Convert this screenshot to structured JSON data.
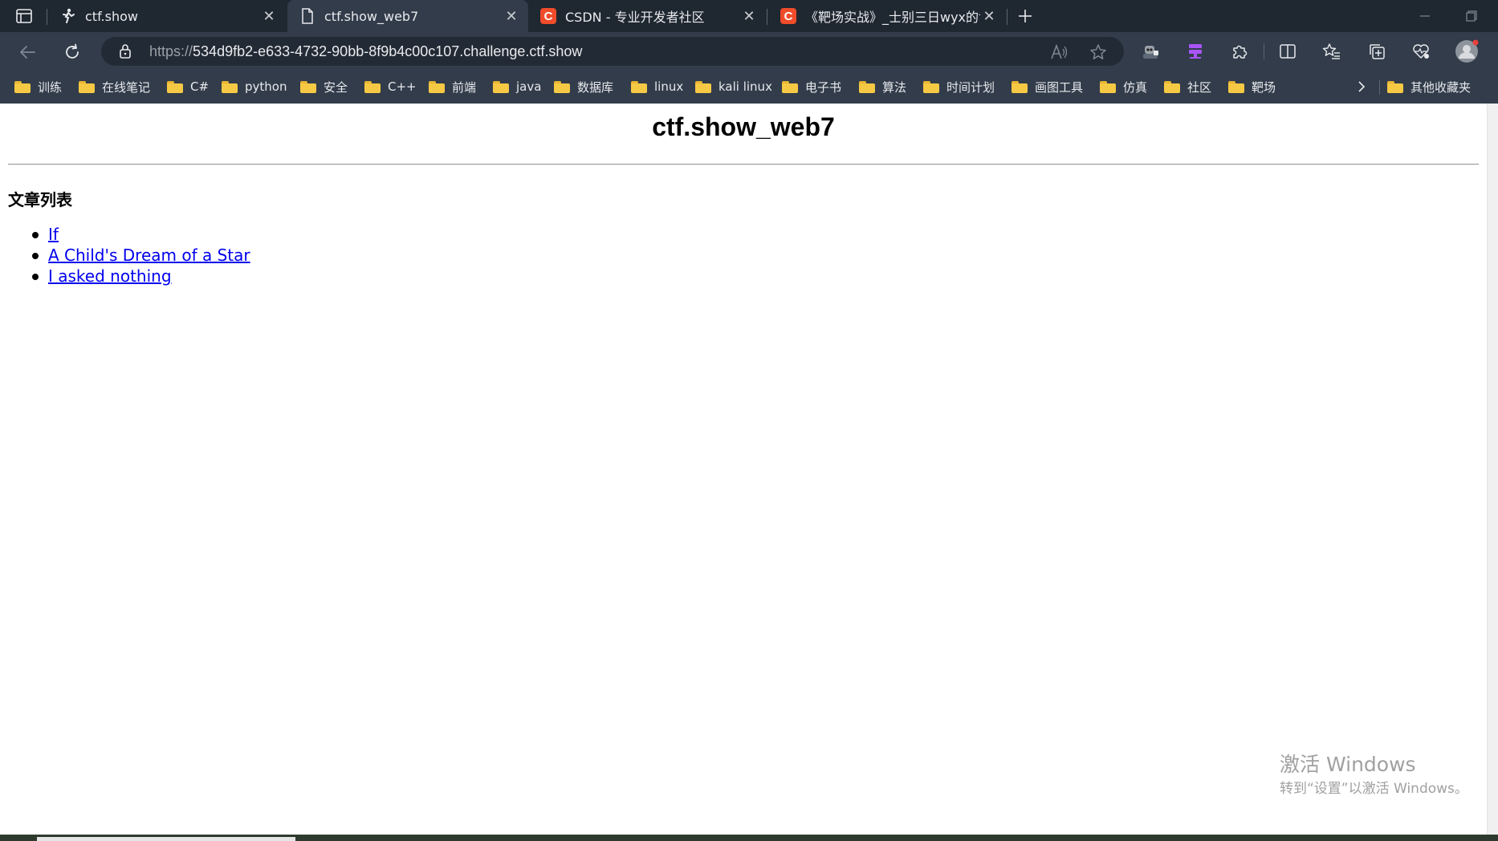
{
  "tabs": [
    {
      "title": "ctf.show",
      "icon": "ctfshow-figure-icon",
      "active": false
    },
    {
      "title": "ctf.show_web7",
      "icon": "page-icon",
      "active": true
    },
    {
      "title": "CSDN - 专业开发者社区",
      "icon": "csdn-logo-icon",
      "active": false
    },
    {
      "title": "《靶场实战》_士别三日wyx的博",
      "icon": "csdn-logo-icon",
      "active": false
    }
  ],
  "csdn_logo_letter": "C",
  "address_bar": {
    "scheme": "https://",
    "host": "534d9fb2-e633-4732-90bb-8f9b4c00c107.challenge.ctf.show"
  },
  "bookmarks": [
    {
      "label": "训练"
    },
    {
      "label": "在线笔记"
    },
    {
      "label": "C#"
    },
    {
      "label": "python"
    },
    {
      "label": "安全"
    },
    {
      "label": "C++"
    },
    {
      "label": "前端"
    },
    {
      "label": "java"
    },
    {
      "label": "数据库"
    },
    {
      "label": "linux"
    },
    {
      "label": "kali linux"
    },
    {
      "label": "电子书"
    },
    {
      "label": "算法"
    },
    {
      "label": "时间计划"
    },
    {
      "label": "画图工具"
    },
    {
      "label": "仿真"
    },
    {
      "label": "社区"
    },
    {
      "label": "靶场"
    }
  ],
  "other_bookmarks": "其他收藏夹",
  "page": {
    "title": "ctf.show_web7",
    "section_heading": "文章列表",
    "articles": [
      {
        "title": "If"
      },
      {
        "title": "A Child's Dream of a Star"
      },
      {
        "title": "I asked nothing"
      }
    ]
  },
  "watermark": {
    "title": "激活 Windows",
    "subtitle": "转到“设置”以激活 Windows。"
  },
  "colors": {
    "chrome_bg": "#323c4a",
    "tabstrip_bg": "#1f2731",
    "link": "#0000ee",
    "folder": "#f6c945",
    "csdn_red": "#f04c2a"
  }
}
